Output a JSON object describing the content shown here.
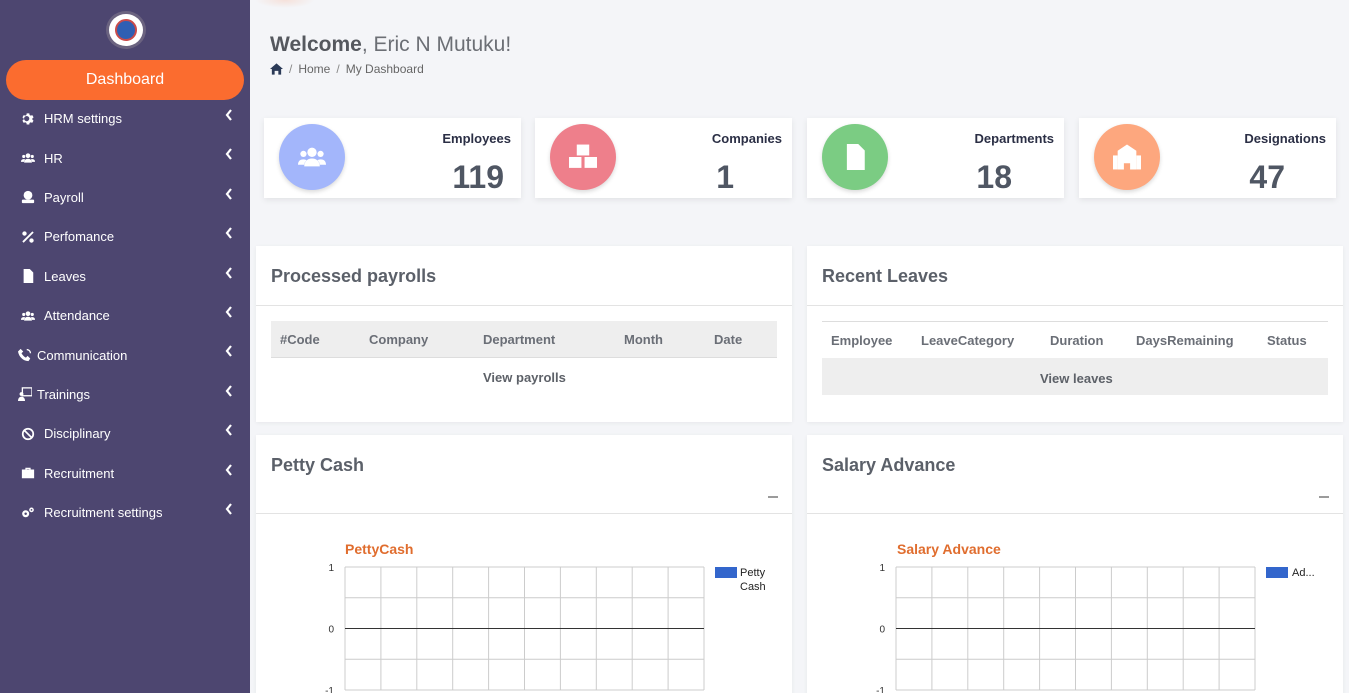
{
  "sidebar": {
    "logo": "company-logo",
    "dashboard_label": "Dashboard",
    "items": [
      {
        "label": "HRM settings",
        "icon": "gear-icon"
      },
      {
        "label": "HR",
        "icon": "users-icon"
      },
      {
        "label": "Payroll",
        "icon": "payroll-icon"
      },
      {
        "label": "Perfomance",
        "icon": "percent-icon"
      },
      {
        "label": "Leaves",
        "icon": "document-icon"
      },
      {
        "label": "Attendance",
        "icon": "users-icon"
      },
      {
        "label": "Communication",
        "icon": "communication-icon"
      },
      {
        "label": "Trainings",
        "icon": "trainer-icon"
      },
      {
        "label": "Disciplinary",
        "icon": "ban-icon"
      },
      {
        "label": "Recruitment",
        "icon": "briefcase-icon"
      },
      {
        "label": "Recruitment settings",
        "icon": "gears-icon"
      }
    ]
  },
  "header": {
    "welcome_bold": "Welcome",
    "welcome_rest": ", Eric N Mutuku!",
    "breadcrumb": [
      "Home",
      "My Dashboard"
    ]
  },
  "stats": [
    {
      "label": "Employees",
      "value": "119",
      "color": "#a3b6fb",
      "icon": "users-icon"
    },
    {
      "label": "Companies",
      "value": "1",
      "color": "#ee7f8b",
      "icon": "boxes-icon"
    },
    {
      "label": "Departments",
      "value": "18",
      "color": "#7bcc83",
      "icon": "document-icon"
    },
    {
      "label": "Designations",
      "value": "47",
      "color": "#fda77e",
      "icon": "building-icon"
    }
  ],
  "payrolls": {
    "title": "Processed payrolls",
    "columns": [
      "#Code",
      "Company",
      "Department",
      "Month",
      "Date"
    ],
    "link": "View payrolls"
  },
  "leaves": {
    "title": "Recent Leaves",
    "columns": [
      "Employee",
      "LeaveCategory",
      "Duration",
      "DaysRemaining",
      "Status"
    ],
    "link": "View leaves"
  },
  "petty": {
    "title": "Petty Cash",
    "chart_title": "PettyCash",
    "legend": [
      "Petty",
      "Cash"
    ]
  },
  "salary": {
    "title": "Salary Advance",
    "chart_title": "Salary Advance",
    "legend": "Ad..."
  },
  "chart_data": [
    {
      "type": "bar",
      "title": "PettyCash",
      "series": [
        {
          "name": "Petty Cash",
          "values": []
        }
      ],
      "ylim": [
        -1,
        1
      ],
      "yticks": [
        "1",
        "0",
        "-1"
      ],
      "grid": true,
      "legend": "right"
    },
    {
      "type": "bar",
      "title": "Salary Advance",
      "series": [
        {
          "name": "Ad...",
          "values": []
        }
      ],
      "ylim": [
        -1,
        1
      ],
      "yticks": [
        "1",
        "0",
        "-1"
      ],
      "grid": true,
      "legend": "right"
    }
  ],
  "colors": {
    "sidebar": "#4d4670",
    "accent": "#fb6c2f",
    "series": "#3366cc"
  }
}
